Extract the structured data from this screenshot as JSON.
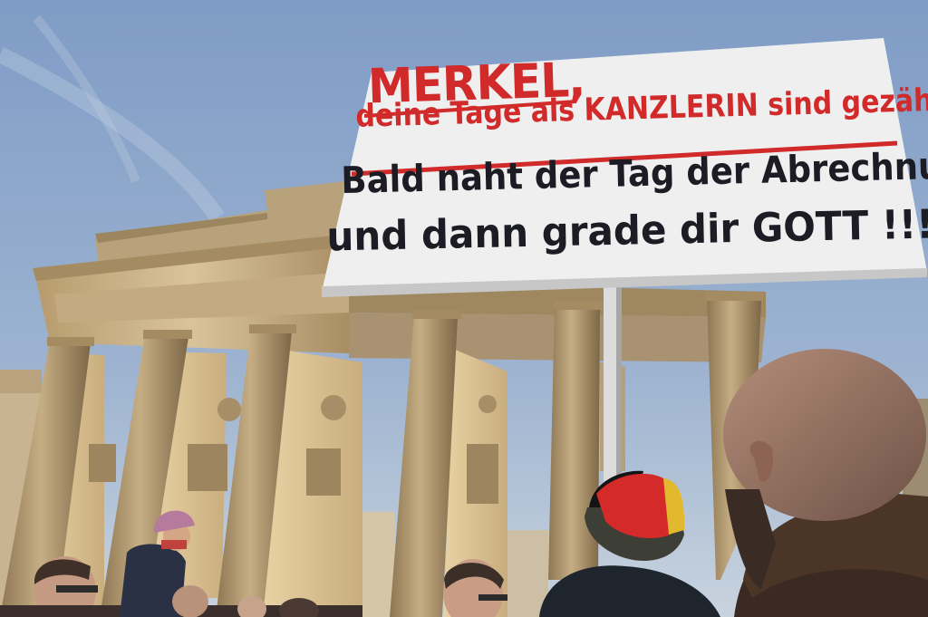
{
  "photo": {
    "sign": {
      "line1": "MERKEL,",
      "line2": "deine Tage als KANZLERIN sind gezählt !",
      "line3": "Bald naht der Tag der Abrechnung",
      "line4": "und dann grade dir GOTT !!!"
    },
    "colors": {
      "sky_top": "#7f9cc6",
      "sky_bottom": "#c5d2df",
      "stone": "#c9b48e",
      "sign_bg": "#efefef",
      "red_text": "#d12a2a",
      "dark_text": "#1b1c24"
    }
  }
}
